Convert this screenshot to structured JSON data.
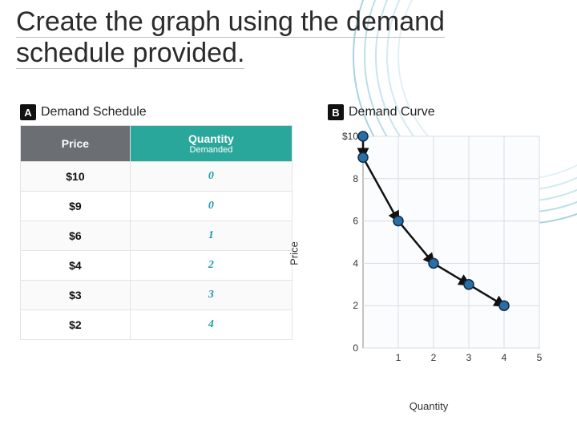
{
  "title_line1": "Create the graph using the demand",
  "title_line2": "schedule provided.",
  "panelA": {
    "badge": "A",
    "title": "Demand Schedule",
    "headers": {
      "price": "Price",
      "qty_line1": "Quantity",
      "qty_line2": "Demanded"
    },
    "rows": [
      {
        "price": "$10",
        "qty": "0"
      },
      {
        "price": "$9",
        "qty": "0"
      },
      {
        "price": "$6",
        "qty": "1"
      },
      {
        "price": "$4",
        "qty": "2"
      },
      {
        "price": "$3",
        "qty": "3"
      },
      {
        "price": "$2",
        "qty": "4"
      }
    ]
  },
  "panelB": {
    "badge": "B",
    "title": "Demand Curve",
    "xlabel": "Quantity",
    "ylabel": "Price",
    "xticks": [
      "1",
      "2",
      "3",
      "4",
      "5"
    ],
    "yticks": [
      "0",
      "2",
      "4",
      "6",
      "8",
      "$10"
    ]
  },
  "chart_data": {
    "type": "line",
    "title": "Demand Curve",
    "xlabel": "Quantity",
    "ylabel": "Price",
    "xlim": [
      0,
      5
    ],
    "ylim": [
      0,
      10
    ],
    "x": [
      0,
      0,
      1,
      2,
      3,
      4
    ],
    "y": [
      10,
      9,
      6,
      4,
      3,
      2
    ],
    "note": "Tick at y=10 is labeled '$10'. Points are joined by a smooth decreasing curve with arrowheads between points."
  }
}
